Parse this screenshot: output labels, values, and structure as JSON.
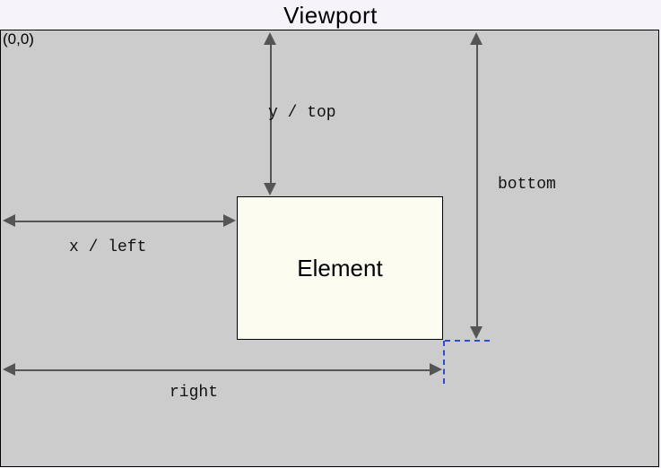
{
  "title": "Viewport",
  "origin_label": "(0,0)",
  "element_label": "Element",
  "labels": {
    "x_left": "x / left",
    "y_top": "y / top",
    "right": "right",
    "bottom": "bottom"
  }
}
